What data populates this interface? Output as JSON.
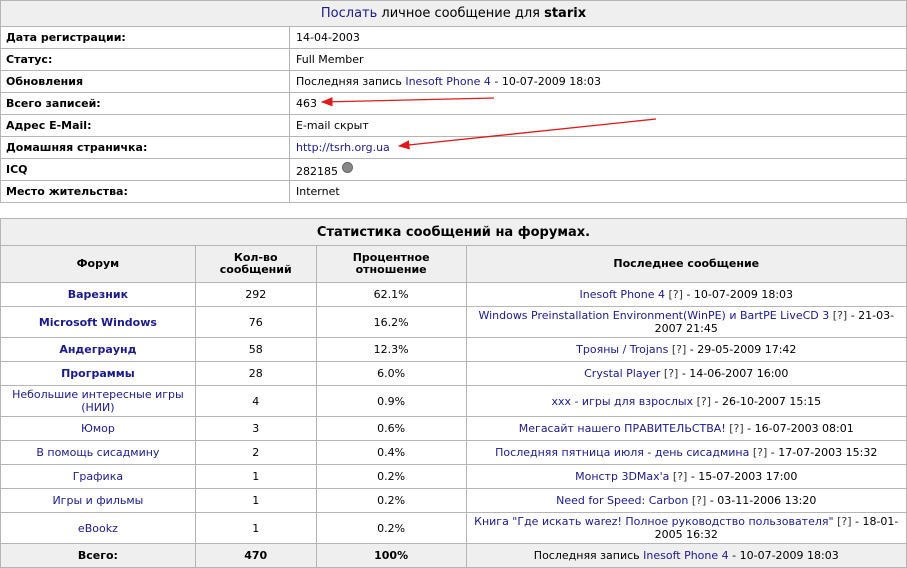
{
  "profile": {
    "header": {
      "pm_link": "Послать",
      "pm_text": " личное сообщение для ",
      "username": "starix"
    },
    "rows": [
      {
        "label": "Дата регистрации:",
        "value": "14-04-2003"
      },
      {
        "label": "Статус:",
        "value": "Full Member"
      },
      {
        "label": "Обновления",
        "prefix": "Последняя запись ",
        "link": "Inesoft Phone 4",
        "suffix": " - 10-07-2009 18:03"
      },
      {
        "label": "Всего записей:",
        "value": "463"
      },
      {
        "label": "Адрес E-Mail:",
        "value": "E-mail скрыт"
      },
      {
        "label": "Домашняя страничка:",
        "link": "http://tsrh.org.ua"
      },
      {
        "label": "ICQ",
        "value": "282185",
        "status_icon": "icq-status-icon"
      },
      {
        "label": "Место жительства:",
        "value": "Internet"
      }
    ]
  },
  "stats": {
    "title": "Статистика сообщений на форумах.",
    "headers": {
      "forum": "Форум",
      "count_line1": "Кол-во",
      "count_line2": "сообщений",
      "pct_line1": "Процентное",
      "pct_line2": "отношение",
      "last": "Последнее сообщение"
    },
    "rows": [
      {
        "forum": "Варезник",
        "bold": true,
        "count": "292",
        "pct": "62.1%",
        "last_link": "Inesoft Phone 4",
        "q": " [?]",
        "last_rest": " - 10-07-2009 18:03"
      },
      {
        "forum": "Microsoft Windows",
        "bold": true,
        "count": "76",
        "pct": "16.2%",
        "last_link": "Windows Preinstallation Environment(WinPE) и BartPE LiveCD 3",
        "q": " [?]",
        "last_rest": " - 21-03-2007 21:45"
      },
      {
        "forum": "Андеграунд",
        "bold": true,
        "count": "58",
        "pct": "12.3%",
        "last_link": "Трояны / Trojans",
        "q": " [?]",
        "last_rest": " - 29-05-2009 17:42"
      },
      {
        "forum": "Программы",
        "bold": true,
        "count": "28",
        "pct": "6.0%",
        "last_link": "Crystal Player",
        "q": " [?]",
        "last_rest": " - 14-06-2007 16:00"
      },
      {
        "forum": "Небольшие интересные игры (НИИ)",
        "bold": false,
        "count": "4",
        "pct": "0.9%",
        "last_link": "xxx - игры для взрослых",
        "q": " [?]",
        "last_rest": " - 26-10-2007 15:15"
      },
      {
        "forum": "Юмор",
        "bold": false,
        "count": "3",
        "pct": "0.6%",
        "last_link": "Мегасайт нашего ПРАВИТЕЛЬСТВА!",
        "q": " [?]",
        "last_rest": " - 16-07-2003 08:01"
      },
      {
        "forum": "В помощь сисадмину",
        "bold": false,
        "count": "2",
        "pct": "0.4%",
        "last_link": "Последняя пятница июля - день сисадмина",
        "q": " [?]",
        "last_rest": " - 17-07-2003 15:32"
      },
      {
        "forum": "Графика",
        "bold": false,
        "count": "1",
        "pct": "0.2%",
        "last_link": "Монстр 3DMax'а",
        "q": " [?]",
        "last_rest": " - 15-07-2003 17:00"
      },
      {
        "forum": "Игры и фильмы",
        "bold": false,
        "count": "1",
        "pct": "0.2%",
        "last_link": "Need for Speed: Carbon",
        "q": " [?]",
        "last_rest": " - 03-11-2006 13:20"
      },
      {
        "forum": "eBookz",
        "bold": false,
        "count": "1",
        "pct": "0.2%",
        "last_link": "Книга \"Где искать warez! Полное руководство пользователя\"",
        "q": " [?]",
        "last_rest": " - 18-01-2005 16:32"
      }
    ],
    "total": {
      "label": "Всего:",
      "count": "470",
      "pct": "100%",
      "prefix": "Последняя запись ",
      "link": "Inesoft Phone 4",
      "suffix": " - 10-07-2009 18:03"
    }
  },
  "colors": {
    "link": "#1a1a8e",
    "header_bg": "#efefef",
    "border": "#b5b5b5",
    "annotation_arrow": "#e0191b"
  }
}
